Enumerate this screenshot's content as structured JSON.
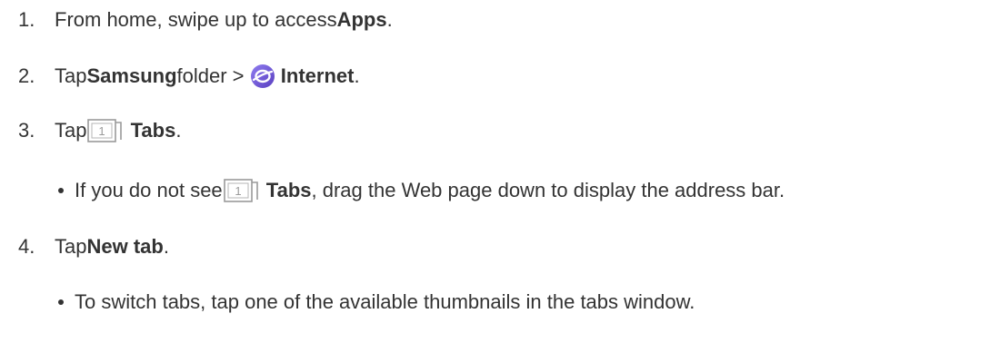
{
  "steps": [
    {
      "number": "1.",
      "parts": [
        "From home, swipe up to access ",
        "Apps",
        "."
      ]
    },
    {
      "number": "2.",
      "parts": [
        "Tap ",
        "Samsung",
        " folder > ",
        "Internet",
        "."
      ],
      "icon": "samsung-internet-icon"
    },
    {
      "number": "3.",
      "parts": [
        "Tap ",
        "Tabs",
        "."
      ],
      "icon": "tabs-icon",
      "tab_count": "1"
    },
    {
      "bullet": true,
      "parts": [
        "If you do not see ",
        "Tabs",
        ", drag the Web page down to display the address bar."
      ],
      "icon": "tabs-icon",
      "tab_count": "1"
    },
    {
      "number": "4.",
      "parts": [
        "Tap ",
        "New tab",
        "."
      ]
    },
    {
      "bullet": true,
      "parts": [
        "To switch tabs, tap one of the available thumbnails in the tabs window."
      ]
    }
  ],
  "colors": {
    "text": "#333333",
    "internet_icon": "#6a5acd",
    "tabs_icon": "#9a9a9a"
  }
}
